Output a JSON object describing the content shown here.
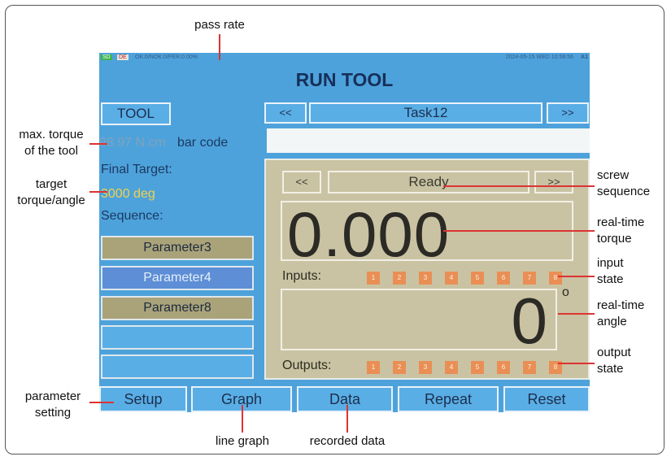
{
  "annotations": {
    "pass_rate": "pass rate",
    "max_torque_l1": "max. torque",
    "max_torque_l2": "of the tool",
    "target_l1": "target",
    "target_l2": "torque/angle",
    "screw_l1": "screw",
    "screw_l2": "sequence",
    "rt_torque_l1": "real-time",
    "rt_torque_l2": "torque",
    "input_l1": "input",
    "input_l2": "state",
    "rt_angle_l1": "real-time",
    "rt_angle_l2": "angle",
    "output_l1": "output",
    "output_l2": "state",
    "param_l1": "parameter",
    "param_l2": "setting",
    "line_graph": "line graph",
    "recorded": "recorded data"
  },
  "status_bar": {
    "sd": "SD",
    "de": "DE",
    "rate": "OK:0/NOK:0/PER:0.00%",
    "datetime": "2024-05-15 WED 10:58:56",
    "a1": "A1"
  },
  "screen": {
    "title": "RUN TOOL",
    "tool_button": "TOOL",
    "task_prev": "<<",
    "task_name": "Task12",
    "task_next": ">>",
    "max_torque": "98.97 N.cm",
    "barcode_label": "bar code",
    "barcode_value": "",
    "final_target_label": "Final Target:",
    "target_value": "3000 deg",
    "sequence_label": "Sequence:",
    "parameters": [
      "Parameter3",
      "Parameter4",
      "Parameter8",
      "",
      ""
    ],
    "seq_prev": "<<",
    "seq_status": "Ready",
    "seq_next": ">>",
    "torque_value": "0.000",
    "inputs_label": "Inputs:",
    "inputs": [
      "1",
      "2",
      "3",
      "4",
      "5",
      "6",
      "7",
      "8"
    ],
    "angle_value": "0",
    "degree_symbol": "o",
    "outputs_label": "Outputs:",
    "outputs": [
      "1",
      "2",
      "3",
      "4",
      "5",
      "6",
      "7",
      "8"
    ],
    "bottom_buttons": [
      "Setup",
      "Graph",
      "Data",
      "Repeat",
      "Reset"
    ]
  },
  "colors": {
    "screen_bg": "#4ea2db",
    "panel_bg": "#c9c3a3",
    "io_box": "#e98f55",
    "annotation_line": "#d33333"
  }
}
